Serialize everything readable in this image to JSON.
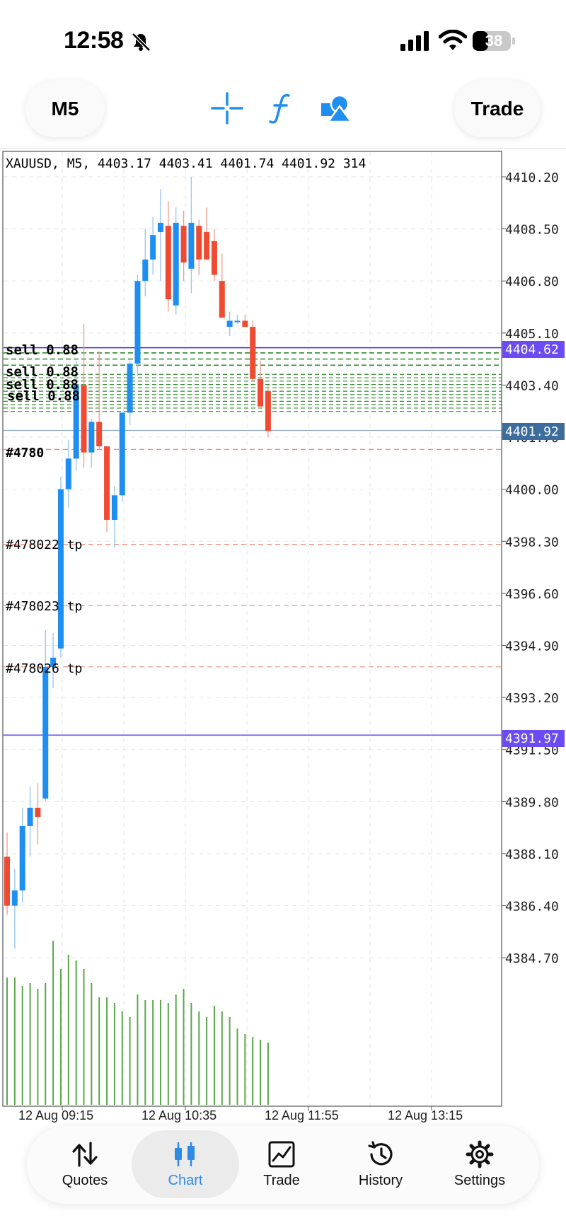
{
  "status_bar": {
    "time": "12:58",
    "battery": "38"
  },
  "toolbar": {
    "timeframe": "M5",
    "trade_label": "Trade"
  },
  "chart_data": {
    "type": "candlestick",
    "header": "XAUUSD, M5, 4403.17 4403.41 4401.74 4401.92 314",
    "y_ticks": [
      "4410.20",
      "4408.50",
      "4406.80",
      "4405.10",
      "4403.40",
      "4401.70",
      "4400.00",
      "4398.30",
      "4396.60",
      "4394.90",
      "4393.20",
      "4391.50",
      "4389.80",
      "4388.10",
      "4386.40",
      "4384.70"
    ],
    "x_ticks": [
      "12 Aug 09:15",
      "12 Aug 10:35",
      "12 Aug 11:55",
      "12 Aug 13:15"
    ],
    "price_tags": {
      "blue_high": "4404.62",
      "current": "4401.92",
      "blue_low": "4391.97"
    },
    "order_labels": {
      "sell_1": "sell 0.88",
      "sell_2": "sell 0.88",
      "tp_cluster": "#4780",
      "tp_1": "#478022 tp",
      "tp_2": "#478023 tp",
      "tp_3": "#478026 tp"
    },
    "candles": [
      {
        "o": 4388.0,
        "h": 4388.8,
        "l": 4386.1,
        "c": 4386.4
      },
      {
        "o": 4386.4,
        "h": 4387.6,
        "l": 4385.0,
        "c": 4386.9
      },
      {
        "o": 4386.9,
        "h": 4389.6,
        "l": 4386.5,
        "c": 4389.0
      },
      {
        "o": 4389.0,
        "h": 4390.3,
        "l": 4388.0,
        "c": 4389.6
      },
      {
        "o": 4389.6,
        "h": 4390.4,
        "l": 4388.4,
        "c": 4389.3
      },
      {
        "o": 4389.9,
        "h": 4395.4,
        "l": 4389.8,
        "c": 4394.2
      },
      {
        "o": 4394.2,
        "h": 4395.3,
        "l": 4393.5,
        "c": 4394.5
      },
      {
        "o": 4394.8,
        "h": 4400.4,
        "l": 4394.5,
        "c": 4400.0
      },
      {
        "o": 4400.0,
        "h": 4401.6,
        "l": 4399.4,
        "c": 4401.0
      },
      {
        "o": 4401.0,
        "h": 4404.2,
        "l": 4400.6,
        "c": 4403.4
      },
      {
        "o": 4403.4,
        "h": 4405.4,
        "l": 4400.7,
        "c": 4401.2
      },
      {
        "o": 4401.2,
        "h": 4402.3,
        "l": 4400.7,
        "c": 4402.2
      },
      {
        "o": 4402.2,
        "h": 4404.5,
        "l": 4401.3,
        "c": 4401.4
      },
      {
        "o": 4401.4,
        "h": 4401.4,
        "l": 4398.6,
        "c": 4399.0
      },
      {
        "o": 4399.0,
        "h": 4400.1,
        "l": 4398.1,
        "c": 4399.8
      },
      {
        "o": 4399.8,
        "h": 4402.5,
        "l": 4399.6,
        "c": 4402.5
      },
      {
        "o": 4402.5,
        "h": 4404.2,
        "l": 4402.1,
        "c": 4404.1
      },
      {
        "o": 4404.1,
        "h": 4407.0,
        "l": 4403.7,
        "c": 4406.8
      },
      {
        "o": 4406.8,
        "h": 4408.5,
        "l": 4406.3,
        "c": 4407.5
      },
      {
        "o": 4407.5,
        "h": 4408.9,
        "l": 4407.0,
        "c": 4408.3
      },
      {
        "o": 4408.4,
        "h": 4409.8,
        "l": 4406.8,
        "c": 4408.7
      },
      {
        "o": 4408.6,
        "h": 4409.4,
        "l": 4405.8,
        "c": 4406.2
      },
      {
        "o": 4406.0,
        "h": 4409.2,
        "l": 4405.7,
        "c": 4408.7
      },
      {
        "o": 4408.6,
        "h": 4409.1,
        "l": 4406.8,
        "c": 4407.4
      },
      {
        "o": 4407.2,
        "h": 4410.2,
        "l": 4406.4,
        "c": 4408.7
      },
      {
        "o": 4408.6,
        "h": 4408.8,
        "l": 4407.0,
        "c": 4407.5
      },
      {
        "o": 4408.4,
        "h": 4409.2,
        "l": 4407.5,
        "c": 4407.5
      },
      {
        "o": 4408.1,
        "h": 4408.5,
        "l": 4406.8,
        "c": 4407.0
      },
      {
        "o": 4406.8,
        "h": 4407.7,
        "l": 4405.6,
        "c": 4405.6
      },
      {
        "o": 4405.3,
        "h": 4405.8,
        "l": 4405.0,
        "c": 4405.5
      },
      {
        "o": 4405.5,
        "h": 4405.7,
        "l": 4405.4,
        "c": 4405.5
      },
      {
        "o": 4405.5,
        "h": 4405.7,
        "l": 4405.3,
        "c": 4405.3
      },
      {
        "o": 4405.3,
        "h": 4405.5,
        "l": 4403.5,
        "c": 4403.6
      },
      {
        "o": 4403.6,
        "h": 4404.2,
        "l": 4402.7,
        "c": 4402.7
      },
      {
        "o": 4403.2,
        "h": 4403.4,
        "l": 4401.7,
        "c": 4401.9
      }
    ],
    "volumes": [
      0.45,
      0.45,
      0.42,
      0.43,
      0.41,
      0.43,
      0.58,
      0.48,
      0.53,
      0.51,
      0.48,
      0.43,
      0.38,
      0.38,
      0.36,
      0.33,
      0.31,
      0.39,
      0.37,
      0.37,
      0.37,
      0.36,
      0.39,
      0.41,
      0.36,
      0.33,
      0.31,
      0.35,
      0.33,
      0.31,
      0.27,
      0.25,
      0.24,
      0.23,
      0.22
    ]
  },
  "nav": {
    "quotes": "Quotes",
    "chart": "Chart",
    "trade": "Trade",
    "history": "History",
    "settings": "Settings"
  },
  "colors": {
    "bull": "#1e8ef0",
    "bear": "#ef4b33",
    "volume": "#5aa84a",
    "order_line": "#2e8b2e",
    "tag_blue": "#6a4cf2",
    "tag_current": "#3d6d9c",
    "tp_line": "#e8917f"
  }
}
